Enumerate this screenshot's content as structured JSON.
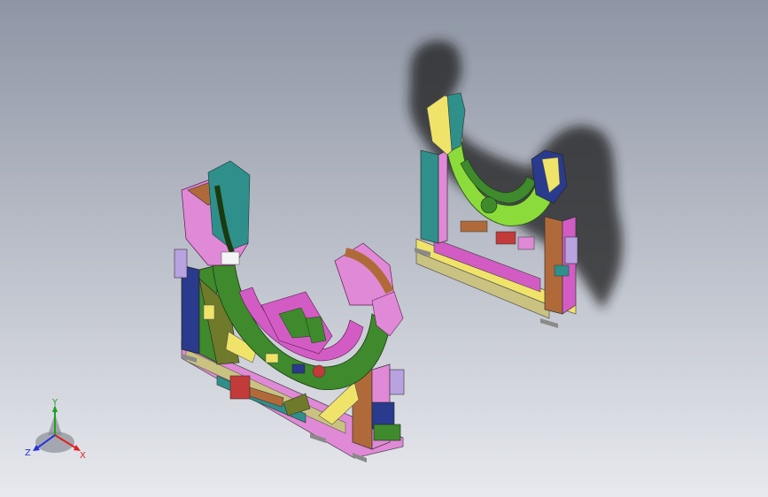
{
  "viewport": {
    "background_top": "#8e95a4",
    "background_bottom": "#e7e9ee",
    "shadow_color": "#1c1c1e"
  },
  "model": {
    "fixtures": [
      "front-fixture",
      "rear-fixture"
    ],
    "colors": {
      "pink": "#e089d6",
      "magenta": "#d25cc4",
      "brown": "#b06a3a",
      "green": "#3e8a2c",
      "lime": "#8bdc3a",
      "yellow": "#f0e36a",
      "khaki": "#c9c281",
      "teal": "#2f8f8a",
      "navy": "#2a3a8c",
      "red": "#c23a3a",
      "gray": "#8a8a8a",
      "lavender": "#b8a2e0",
      "olive": "#6f7a2a"
    }
  },
  "triad": {
    "x_label": "X",
    "y_label": "Y",
    "z_label": "Z",
    "x_color": "#e02020",
    "y_color": "#20a020",
    "z_color": "#2030e0"
  }
}
